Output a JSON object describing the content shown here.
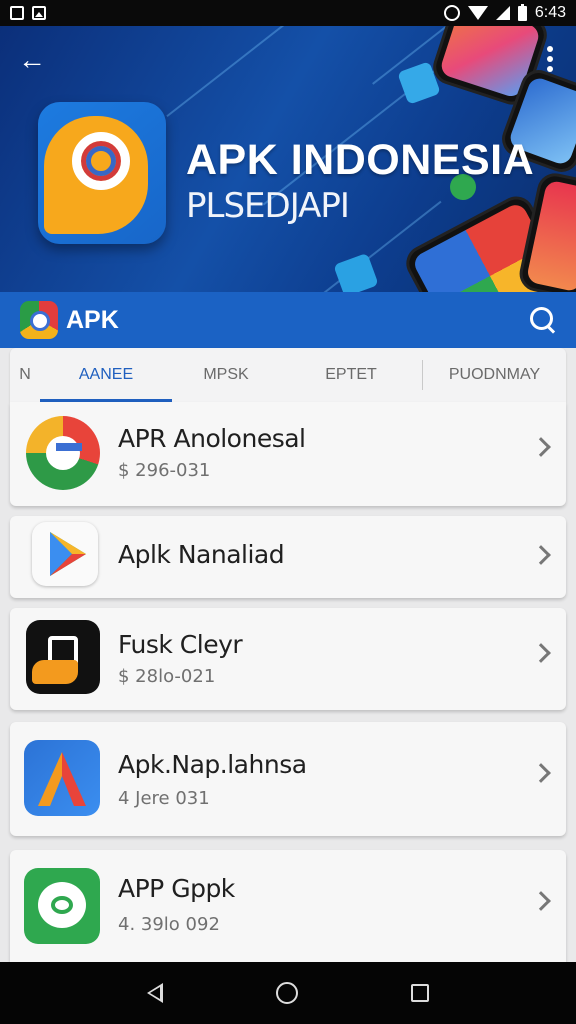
{
  "status_bar": {
    "time": "6:43",
    "icons": [
      "notification-square-icon",
      "image-icon",
      "alarm-icon",
      "wifi-icon",
      "signal-icon",
      "battery-icon"
    ]
  },
  "hero": {
    "title": "APK INDONESIA",
    "subtitle": "PLSEDJAPI",
    "icons": [
      "back-arrow-icon",
      "overflow-menu-icon"
    ]
  },
  "app_bar": {
    "title": "APK",
    "icons": [
      "app-logo-icon",
      "search-icon"
    ]
  },
  "tabs": [
    {
      "label": "N"
    },
    {
      "label": "AANEE",
      "active": true
    },
    {
      "label": "MPSK"
    },
    {
      "label": "EPTET"
    },
    {
      "label": "PUODNMAY"
    }
  ],
  "list": [
    {
      "name": "APR Anolonesal",
      "sub": "$ 296-031",
      "icon": "google-style-app-icon"
    },
    {
      "name": "Aplk Nanaliad",
      "sub": "",
      "icon": "play-store-icon"
    },
    {
      "name": "Fusk Cleyr",
      "sub": "$ 28lo-021",
      "icon": "hand-cleaner-icon"
    },
    {
      "name": "Apk.Nap.lahnsa",
      "sub": "4 Jere 031",
      "icon": "letter-a-icon"
    },
    {
      "name": "APP Gppk",
      "sub": "4. 39lo 092",
      "icon": "green-chat-icon"
    }
  ],
  "colors": {
    "app_bar": "#1b62c4",
    "active_tab": "#1f5fbf",
    "hero_bg": "#0d3d8e"
  }
}
